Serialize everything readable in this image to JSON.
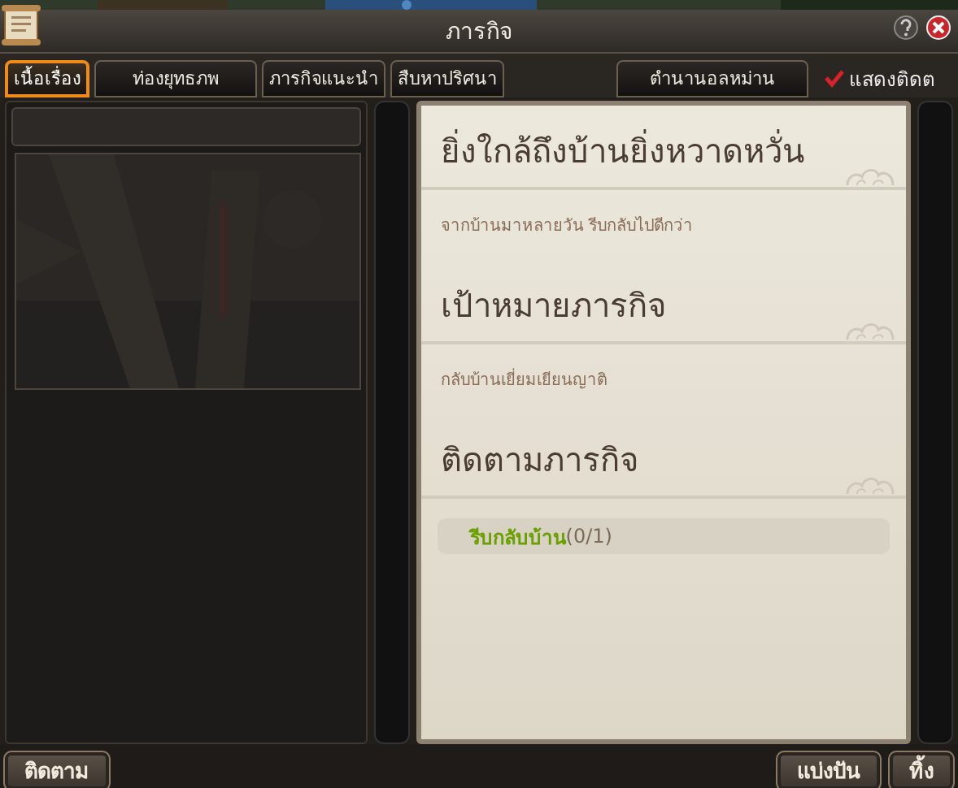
{
  "window": {
    "title": "ภารกิจ"
  },
  "tabs": [
    {
      "label": "เนื้อเรื่อง",
      "selected": true
    },
    {
      "label": "ท่องยุทธภพ",
      "selected": false
    },
    {
      "label": "ภารกิจแนะนำ",
      "selected": false
    },
    {
      "label": "สืบหาปริศนา",
      "selected": false
    },
    {
      "label": "ตำนานอลหม่าน",
      "selected": false
    }
  ],
  "show_tracking": {
    "label": "แสดงติดต",
    "checked": true
  },
  "left_panel": {
    "preview": {
      "kind": "picture"
    }
  },
  "quest": {
    "sections": [
      {
        "heading": "ยิ่งใกล้ถึงบ้านยิ่งหวาดหวั่น",
        "text": "จากบ้านมาหลายวัน รีบกลับไปดีกว่า"
      },
      {
        "heading": "เป้าหมายภารกิจ",
        "text": "กลับบ้านเยี่ยมเยียนญาติ"
      },
      {
        "heading": "ติดตามภารกิจ"
      }
    ],
    "objectives": [
      {
        "name": "รีบกลับบ้าน",
        "progress": "(0/1)"
      }
    ]
  },
  "left_buttons": [
    "ติดตาม"
  ],
  "right_buttons": [
    "แบ่งปัน",
    "ทิ้ง"
  ]
}
